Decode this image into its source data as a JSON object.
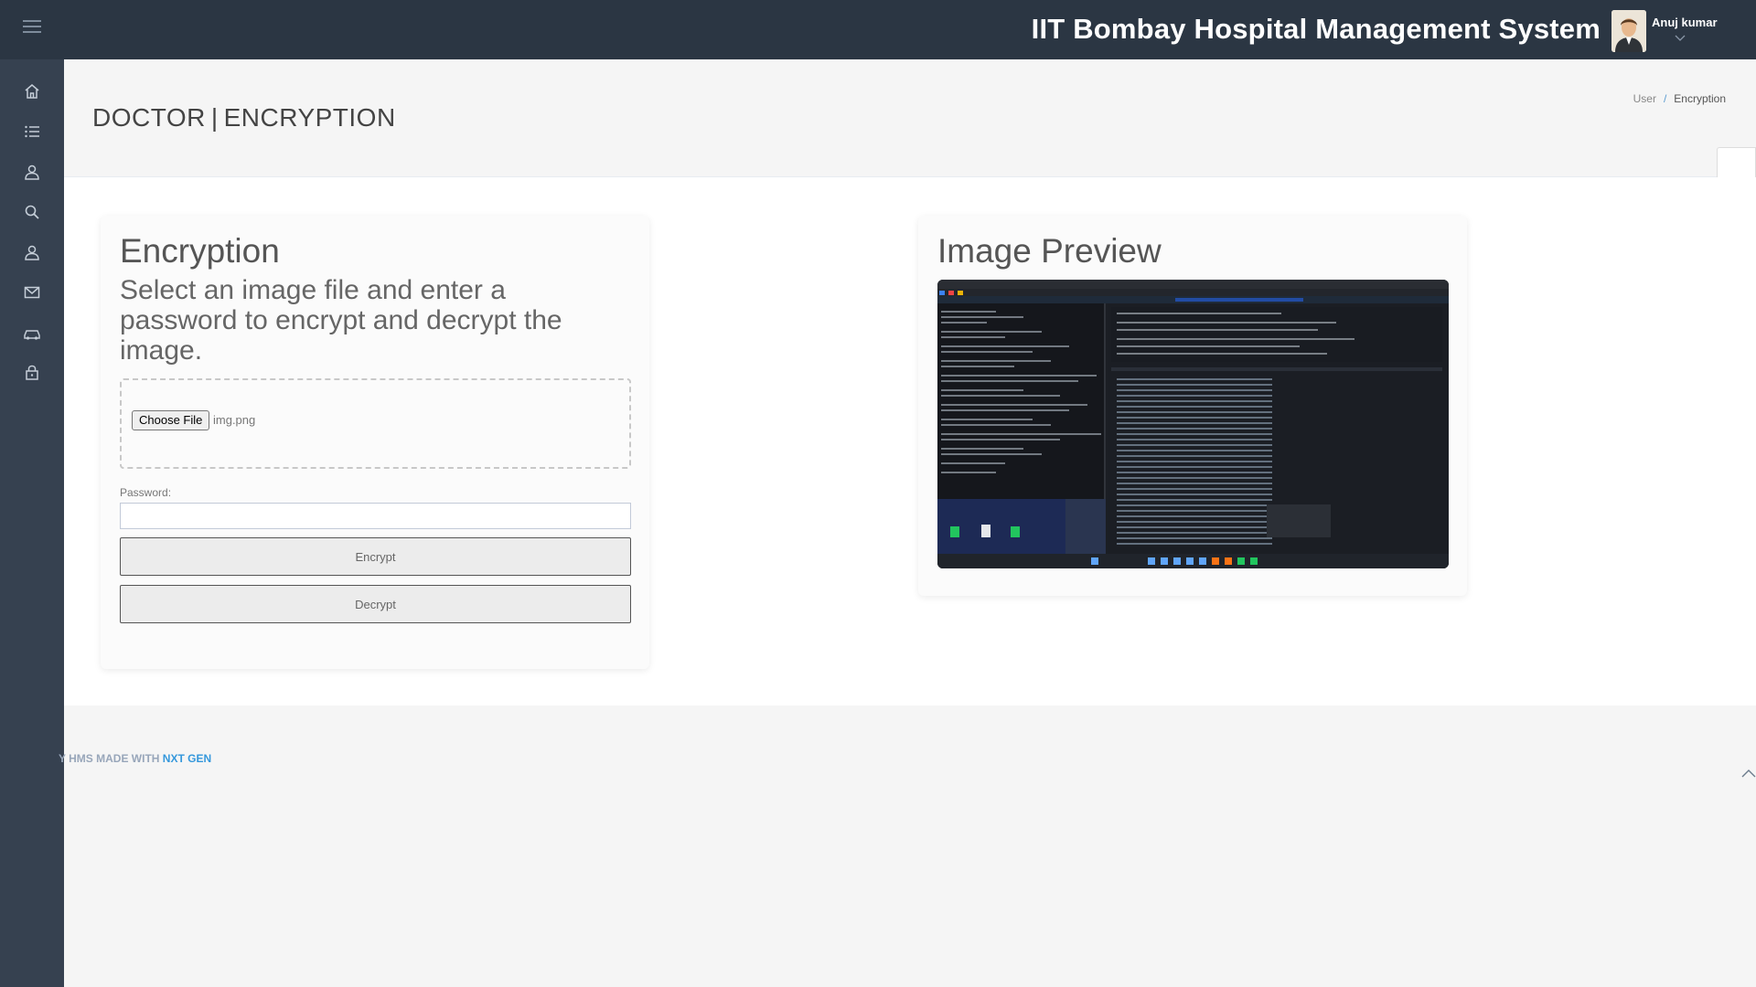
{
  "header": {
    "app_title": "IIT Bombay Hospital Management System",
    "user_name": "Anuj kumar",
    "menu_icon": "hamburger-icon",
    "avatar_icon": "user-avatar",
    "user_menu_icon": "chevron-down-icon"
  },
  "sidebar": {
    "items": [
      {
        "icon": "home-icon"
      },
      {
        "icon": "list-icon"
      },
      {
        "icon": "user-icon"
      },
      {
        "icon": "search-icon"
      },
      {
        "icon": "user-icon"
      },
      {
        "icon": "envelope-icon"
      },
      {
        "icon": "car-icon"
      },
      {
        "icon": "lock-icon"
      }
    ]
  },
  "page": {
    "title_left": "DOCTOR",
    "title_sep": "|",
    "title_right": "ENCRYPTION",
    "breadcrumb": {
      "parent": "User",
      "separator": "/",
      "current": "Encryption"
    }
  },
  "encryption": {
    "heading": "Encryption",
    "instructions": "Select an image file and enter a password to encrypt and decrypt the image.",
    "choose_file_label": "Choose File",
    "file_name": "img.png",
    "password_label": "Password:",
    "password_value": "",
    "encrypt_label": "Encrypt",
    "decrypt_label": "Decrypt"
  },
  "preview": {
    "heading": "Image Preview"
  },
  "footer": {
    "text": "Y HMS MADE WITH ",
    "brand": "NXT GEN",
    "scroll_top_icon": "chevron-up-icon"
  },
  "colors": {
    "topbar": "#2b3643",
    "sidebar": "#364150",
    "accent": "#3598dc"
  }
}
